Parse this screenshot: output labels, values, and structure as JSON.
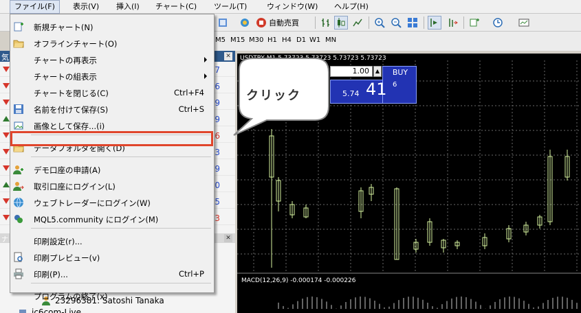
{
  "menubar": {
    "items": [
      {
        "label": "ファイル(F)"
      },
      {
        "label": "表示(V)"
      },
      {
        "label": "挿入(I)"
      },
      {
        "label": "チャート(C)"
      },
      {
        "label": "ツール(T)"
      },
      {
        "label": "ウィンドウ(W)"
      },
      {
        "label": "ヘルプ(H)"
      }
    ]
  },
  "toolbar": {
    "autotrade_label": "自動売買"
  },
  "timeframes": [
    "M5",
    "M15",
    "M30",
    "H1",
    "H4",
    "D1",
    "W1",
    "MN"
  ],
  "market_watch": {
    "header": "気",
    "row_digits": [
      "7",
      "6",
      "9",
      "9",
      "6",
      "3",
      "9",
      "0",
      "5",
      "3"
    ],
    "row_dirs": [
      "down",
      "down",
      "down",
      "up",
      "down",
      "down",
      "down",
      "up",
      "down",
      "down"
    ]
  },
  "navigator": {
    "header": "ナ",
    "account_label": "23296381: Satoshi Tanaka",
    "server_label": "jc6com-Live"
  },
  "file_menu": {
    "items": [
      {
        "label": "新規チャート(N)",
        "shortcut": "",
        "submenu": false,
        "icon": "new-chart-icon"
      },
      {
        "label": "オフラインチャート(O)",
        "shortcut": "",
        "submenu": false,
        "icon": "folder-open-icon"
      },
      {
        "label": "チャートの再表示",
        "shortcut": "",
        "submenu": true,
        "icon": ""
      },
      {
        "label": "チャートの組表示",
        "shortcut": "",
        "submenu": true,
        "icon": ""
      },
      {
        "label": "チャートを閉じる(C)",
        "shortcut": "Ctrl+F4",
        "submenu": false,
        "icon": ""
      },
      {
        "label": "名前を付けて保存(S)",
        "shortcut": "Ctrl+S",
        "submenu": false,
        "icon": "save-icon"
      },
      {
        "label": "画像として保存...(i)",
        "shortcut": "",
        "submenu": false,
        "icon": "save-image-icon"
      },
      {
        "label": "データフォルダを開く(D)",
        "shortcut": "",
        "submenu": false,
        "icon": "folder-icon"
      },
      {
        "label": "デモ口座の申請(A)",
        "shortcut": "",
        "submenu": false,
        "icon": "demo-account-icon"
      },
      {
        "label": "取引口座にログイン(L)",
        "shortcut": "",
        "submenu": false,
        "icon": "login-icon"
      },
      {
        "label": "ウェブトレーダーにログイン(W)",
        "shortcut": "",
        "submenu": false,
        "icon": "webtrader-icon"
      },
      {
        "label": "MQL5.community にログイン(M)",
        "shortcut": "",
        "submenu": false,
        "icon": "mql5-icon"
      },
      {
        "label": "印刷設定(r)...",
        "shortcut": "",
        "submenu": false,
        "icon": ""
      },
      {
        "label": "印刷プレビュー(v)",
        "shortcut": "",
        "submenu": false,
        "icon": "print-preview-icon"
      },
      {
        "label": "印刷(P)...",
        "shortcut": "Ctrl+P",
        "submenu": false,
        "icon": "print-icon"
      },
      {
        "label": "プログラムの終了(x)",
        "shortcut": "",
        "submenu": false,
        "icon": ""
      }
    ]
  },
  "chart": {
    "title": "USDTRY,M1  5.73723 5.73723 5.73723 5.73723",
    "lot": "1.00",
    "buy_label": "BUY",
    "price_small": "5.74",
    "price_big": "41",
    "price_sup": "6",
    "macd_label": "MACD(12,26,9) -0.000174 -0.000226"
  },
  "callout": {
    "text": "クリック"
  },
  "colors": {
    "bullish": "#d7f5a0",
    "grid": "#6a6a6a",
    "highlight_frame": "#e0452b",
    "buy_panel": "#2233b3"
  }
}
